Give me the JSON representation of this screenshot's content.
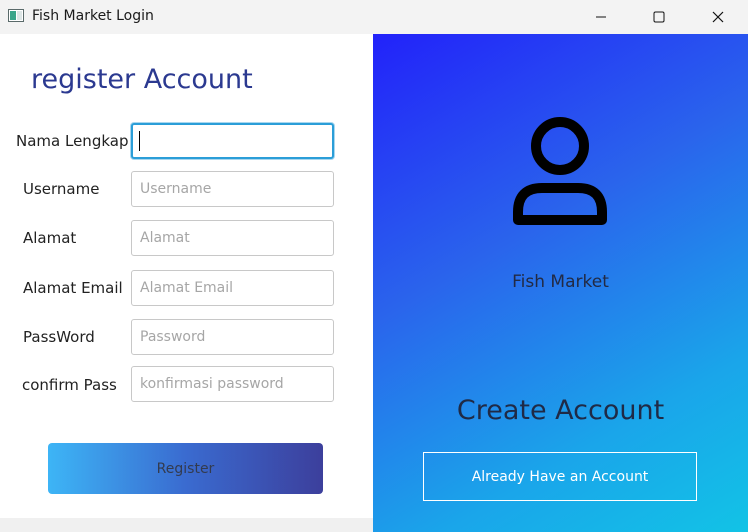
{
  "window": {
    "title": "Fish Market Login"
  },
  "form": {
    "title": "register Account",
    "fields": [
      {
        "label": "Nama Lengkap",
        "value": "",
        "placeholder": ""
      },
      {
        "label": "Username",
        "value": "",
        "placeholder": "Username"
      },
      {
        "label": "Alamat",
        "value": "",
        "placeholder": "Alamat"
      },
      {
        "label": "Alamat Email",
        "value": "",
        "placeholder": "Alamat Email"
      },
      {
        "label": "PassWord",
        "value": "",
        "placeholder": "Password"
      },
      {
        "label": "confirm Pass",
        "value": "",
        "placeholder": "konfirmasi password"
      }
    ],
    "register_label": "Register"
  },
  "side": {
    "icon": "user-icon",
    "brand": "Fish Market",
    "heading": "Create Account",
    "login_label": "Already Have an Account"
  },
  "colors": {
    "title_accent": "#2b3990",
    "focus_border": "#2b9ed8",
    "panel_gradient_start": "#2222fa",
    "panel_gradient_end": "#12c3e6"
  }
}
